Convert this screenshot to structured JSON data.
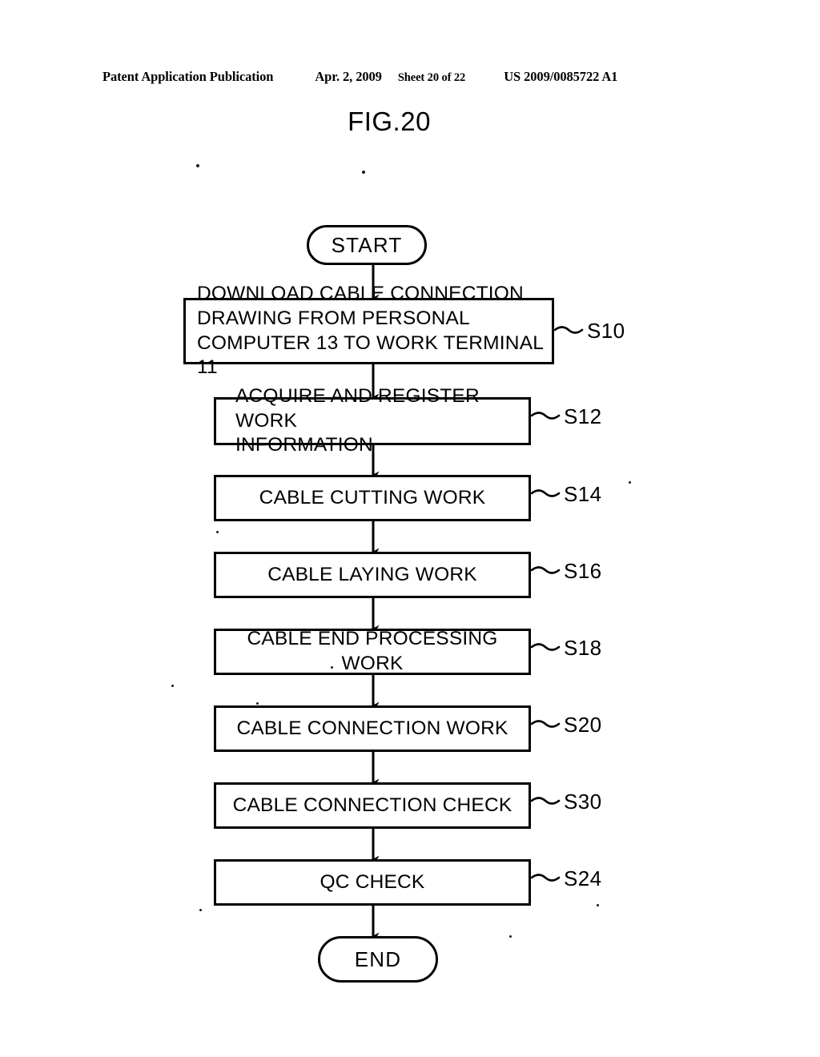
{
  "header": {
    "publication": "Patent Application Publication",
    "date": "Apr. 2, 2009",
    "sheet": "Sheet 20 of 22",
    "patent_number": "US 2009/0085722 A1"
  },
  "figure": {
    "title": "FIG.20"
  },
  "flowchart": {
    "start_label": "START",
    "end_label": "END",
    "steps": [
      {
        "text": "DOWNLOAD CABLE CONNECTION\nDRAWING FROM PERSONAL\nCOMPUTER 13 TO WORK TERMINAL 11",
        "ref": "S10",
        "align": "left"
      },
      {
        "text": "ACQUIRE AND REGISTER WORK\nINFORMATION",
        "ref": "S12",
        "align": "left"
      },
      {
        "text": "CABLE CUTTING WORK",
        "ref": "S14",
        "align": "center"
      },
      {
        "text": "CABLE LAYING WORK",
        "ref": "S16",
        "align": "center"
      },
      {
        "text": "CABLE END PROCESSING WORK",
        "ref": "S18",
        "align": "center"
      },
      {
        "text": "CABLE CONNECTION WORK",
        "ref": "S20",
        "align": "center"
      },
      {
        "text": "CABLE CONNECTION CHECK",
        "ref": "S30",
        "align": "center"
      },
      {
        "text": "QC CHECK",
        "ref": "S24",
        "align": "center"
      }
    ]
  },
  "colors": {
    "ink": "#000000",
    "paper": "#ffffff"
  }
}
